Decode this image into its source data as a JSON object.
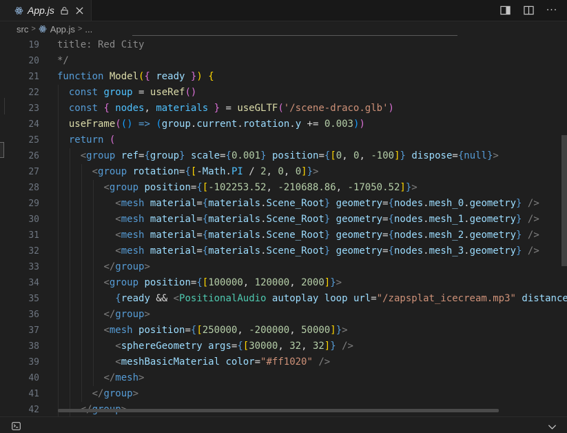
{
  "tab": {
    "icon": "react-icon",
    "label": "App.js",
    "lock_icon": "lock-icon",
    "close_icon": "close-icon"
  },
  "actions": [
    {
      "name": "toggle-secondary-sidebar-button",
      "icon": "sidebar-right-icon"
    },
    {
      "name": "split-editor-button",
      "icon": "split-editor-icon"
    },
    {
      "name": "more-actions-button",
      "label": "···"
    }
  ],
  "breadcrumb": {
    "folder": "src",
    "file": "App.js",
    "more": "..."
  },
  "line_numbers": [
    "19",
    "20",
    "21",
    "22",
    "23",
    "24",
    "25",
    "26",
    "27",
    "28",
    "29",
    "30",
    "31",
    "32",
    "33",
    "34",
    "35",
    "36",
    "37",
    "38",
    "39",
    "40",
    "41",
    "42"
  ],
  "code_lines": [
    [
      [
        "cm",
        "title: Red City"
      ]
    ],
    [
      [
        "cm",
        "*/"
      ]
    ],
    [
      [
        "k",
        "function "
      ],
      [
        "f",
        "Model"
      ],
      [
        "b1",
        "("
      ],
      [
        "b2",
        "{ "
      ],
      [
        "p",
        "ready"
      ],
      [
        "b2",
        " }"
      ],
      [
        "b1",
        ")"
      ],
      [
        "v",
        " "
      ],
      [
        "b1",
        "{"
      ]
    ],
    [
      [
        "v",
        "  "
      ],
      [
        "k",
        "const "
      ],
      [
        "c2",
        "group"
      ],
      [
        "v",
        " = "
      ],
      [
        "f",
        "useRef"
      ],
      [
        "b2",
        "()"
      ]
    ],
    [
      [
        "v",
        "  "
      ],
      [
        "k",
        "const "
      ],
      [
        "b2",
        "{ "
      ],
      [
        "c2",
        "nodes"
      ],
      [
        "v",
        ", "
      ],
      [
        "c2",
        "materials"
      ],
      [
        "b2",
        " }"
      ],
      [
        "v",
        " = "
      ],
      [
        "f",
        "useGLTF"
      ],
      [
        "b2",
        "("
      ],
      [
        "s",
        "'/scene-draco.glb'"
      ],
      [
        "b2",
        ")"
      ]
    ],
    [
      [
        "v",
        "  "
      ],
      [
        "f",
        "useFrame"
      ],
      [
        "b2",
        "("
      ],
      [
        "b3",
        "()"
      ],
      [
        "v",
        " "
      ],
      [
        "k",
        "=>"
      ],
      [
        "v",
        " "
      ],
      [
        "b3",
        "("
      ],
      [
        "p",
        "group"
      ],
      [
        "v",
        "."
      ],
      [
        "p",
        "current"
      ],
      [
        "v",
        "."
      ],
      [
        "p",
        "rotation"
      ],
      [
        "v",
        "."
      ],
      [
        "p",
        "y"
      ],
      [
        "v",
        " += "
      ],
      [
        "n",
        "0.003"
      ],
      [
        "b3",
        ")"
      ],
      [
        "b2",
        ")"
      ]
    ],
    [
      [
        "v",
        "  "
      ],
      [
        "k",
        "return "
      ],
      [
        "b2",
        "("
      ]
    ],
    [
      [
        "v",
        "    "
      ],
      [
        "g",
        "<"
      ],
      [
        "k",
        "group "
      ],
      [
        "p",
        "ref"
      ],
      [
        "v",
        "="
      ],
      [
        "k",
        "{"
      ],
      [
        "p",
        "group"
      ],
      [
        "k",
        "}"
      ],
      [
        "v",
        " "
      ],
      [
        "p",
        "scale"
      ],
      [
        "v",
        "="
      ],
      [
        "k",
        "{"
      ],
      [
        "n",
        "0.001"
      ],
      [
        "k",
        "}"
      ],
      [
        "v",
        " "
      ],
      [
        "p",
        "position"
      ],
      [
        "v",
        "="
      ],
      [
        "k",
        "{"
      ],
      [
        "b1",
        "["
      ],
      [
        "n",
        "0"
      ],
      [
        "v",
        ", "
      ],
      [
        "n",
        "0"
      ],
      [
        "v",
        ", "
      ],
      [
        "n",
        "-100"
      ],
      [
        "b1",
        "]"
      ],
      [
        "k",
        "}"
      ],
      [
        "v",
        " "
      ],
      [
        "p",
        "dispose"
      ],
      [
        "v",
        "="
      ],
      [
        "k",
        "{"
      ],
      [
        "k",
        "null"
      ],
      [
        "k",
        "}"
      ],
      [
        "g",
        ">"
      ]
    ],
    [
      [
        "v",
        "      "
      ],
      [
        "g",
        "<"
      ],
      [
        "k",
        "group "
      ],
      [
        "p",
        "rotation"
      ],
      [
        "v",
        "="
      ],
      [
        "k",
        "{"
      ],
      [
        "b1",
        "["
      ],
      [
        "v",
        "-"
      ],
      [
        "p",
        "Math"
      ],
      [
        "v",
        "."
      ],
      [
        "c2",
        "PI"
      ],
      [
        "v",
        " / "
      ],
      [
        "n",
        "2"
      ],
      [
        "v",
        ", "
      ],
      [
        "n",
        "0"
      ],
      [
        "v",
        ", "
      ],
      [
        "n",
        "0"
      ],
      [
        "b1",
        "]"
      ],
      [
        "k",
        "}"
      ],
      [
        "g",
        ">"
      ]
    ],
    [
      [
        "v",
        "        "
      ],
      [
        "g",
        "<"
      ],
      [
        "k",
        "group "
      ],
      [
        "p",
        "position"
      ],
      [
        "v",
        "="
      ],
      [
        "k",
        "{"
      ],
      [
        "b1",
        "["
      ],
      [
        "n",
        "-102253.52"
      ],
      [
        "v",
        ", "
      ],
      [
        "n",
        "-210688.86"
      ],
      [
        "v",
        ", "
      ],
      [
        "n",
        "-17050.52"
      ],
      [
        "b1",
        "]"
      ],
      [
        "k",
        "}"
      ],
      [
        "g",
        ">"
      ]
    ],
    [
      [
        "v",
        "          "
      ],
      [
        "g",
        "<"
      ],
      [
        "k",
        "mesh "
      ],
      [
        "p",
        "material"
      ],
      [
        "v",
        "="
      ],
      [
        "k",
        "{"
      ],
      [
        "p",
        "materials"
      ],
      [
        "v",
        "."
      ],
      [
        "p",
        "Scene_Root"
      ],
      [
        "k",
        "}"
      ],
      [
        "v",
        " "
      ],
      [
        "p",
        "geometry"
      ],
      [
        "v",
        "="
      ],
      [
        "k",
        "{"
      ],
      [
        "p",
        "nodes"
      ],
      [
        "v",
        "."
      ],
      [
        "p",
        "mesh_0"
      ],
      [
        "v",
        "."
      ],
      [
        "p",
        "geometry"
      ],
      [
        "k",
        "}"
      ],
      [
        "v",
        " "
      ],
      [
        "g",
        "/>"
      ]
    ],
    [
      [
        "v",
        "          "
      ],
      [
        "g",
        "<"
      ],
      [
        "k",
        "mesh "
      ],
      [
        "p",
        "material"
      ],
      [
        "v",
        "="
      ],
      [
        "k",
        "{"
      ],
      [
        "p",
        "materials"
      ],
      [
        "v",
        "."
      ],
      [
        "p",
        "Scene_Root"
      ],
      [
        "k",
        "}"
      ],
      [
        "v",
        " "
      ],
      [
        "p",
        "geometry"
      ],
      [
        "v",
        "="
      ],
      [
        "k",
        "{"
      ],
      [
        "p",
        "nodes"
      ],
      [
        "v",
        "."
      ],
      [
        "p",
        "mesh_1"
      ],
      [
        "v",
        "."
      ],
      [
        "p",
        "geometry"
      ],
      [
        "k",
        "}"
      ],
      [
        "v",
        " "
      ],
      [
        "g",
        "/>"
      ]
    ],
    [
      [
        "v",
        "          "
      ],
      [
        "g",
        "<"
      ],
      [
        "k",
        "mesh "
      ],
      [
        "p",
        "material"
      ],
      [
        "v",
        "="
      ],
      [
        "k",
        "{"
      ],
      [
        "p",
        "materials"
      ],
      [
        "v",
        "."
      ],
      [
        "p",
        "Scene_Root"
      ],
      [
        "k",
        "}"
      ],
      [
        "v",
        " "
      ],
      [
        "p",
        "geometry"
      ],
      [
        "v",
        "="
      ],
      [
        "k",
        "{"
      ],
      [
        "p",
        "nodes"
      ],
      [
        "v",
        "."
      ],
      [
        "p",
        "mesh_2"
      ],
      [
        "v",
        "."
      ],
      [
        "p",
        "geometry"
      ],
      [
        "k",
        "}"
      ],
      [
        "v",
        " "
      ],
      [
        "g",
        "/>"
      ]
    ],
    [
      [
        "v",
        "          "
      ],
      [
        "g",
        "<"
      ],
      [
        "k",
        "mesh "
      ],
      [
        "p",
        "material"
      ],
      [
        "v",
        "="
      ],
      [
        "k",
        "{"
      ],
      [
        "p",
        "materials"
      ],
      [
        "v",
        "."
      ],
      [
        "p",
        "Scene_Root"
      ],
      [
        "k",
        "}"
      ],
      [
        "v",
        " "
      ],
      [
        "p",
        "geometry"
      ],
      [
        "v",
        "="
      ],
      [
        "k",
        "{"
      ],
      [
        "p",
        "nodes"
      ],
      [
        "v",
        "."
      ],
      [
        "p",
        "mesh_3"
      ],
      [
        "v",
        "."
      ],
      [
        "p",
        "geometry"
      ],
      [
        "k",
        "}"
      ],
      [
        "v",
        " "
      ],
      [
        "g",
        "/>"
      ]
    ],
    [
      [
        "v",
        "        "
      ],
      [
        "g",
        "</"
      ],
      [
        "k",
        "group"
      ],
      [
        "g",
        ">"
      ]
    ],
    [
      [
        "v",
        "        "
      ],
      [
        "g",
        "<"
      ],
      [
        "k",
        "group "
      ],
      [
        "p",
        "position"
      ],
      [
        "v",
        "="
      ],
      [
        "k",
        "{"
      ],
      [
        "b1",
        "["
      ],
      [
        "n",
        "100000"
      ],
      [
        "v",
        ", "
      ],
      [
        "n",
        "120000"
      ],
      [
        "v",
        ", "
      ],
      [
        "n",
        "2000"
      ],
      [
        "b1",
        "]"
      ],
      [
        "k",
        "}"
      ],
      [
        "g",
        ">"
      ]
    ],
    [
      [
        "v",
        "          "
      ],
      [
        "k",
        "{"
      ],
      [
        "p",
        "ready"
      ],
      [
        "v",
        " && "
      ],
      [
        "g",
        "<"
      ],
      [
        "t",
        "PositionalAudio "
      ],
      [
        "p",
        "autoplay"
      ],
      [
        "v",
        " "
      ],
      [
        "p",
        "loop"
      ],
      [
        "v",
        " "
      ],
      [
        "p",
        "url"
      ],
      [
        "v",
        "="
      ],
      [
        "s",
        "\"/zapsplat_icecream.mp3\""
      ],
      [
        "v",
        " "
      ],
      [
        "p",
        "distance"
      ]
    ],
    [
      [
        "v",
        "        "
      ],
      [
        "g",
        "</"
      ],
      [
        "k",
        "group"
      ],
      [
        "g",
        ">"
      ]
    ],
    [
      [
        "v",
        "        "
      ],
      [
        "g",
        "<"
      ],
      [
        "k",
        "mesh "
      ],
      [
        "p",
        "position"
      ],
      [
        "v",
        "="
      ],
      [
        "k",
        "{"
      ],
      [
        "b1",
        "["
      ],
      [
        "n",
        "250000"
      ],
      [
        "v",
        ", "
      ],
      [
        "n",
        "-200000"
      ],
      [
        "v",
        ", "
      ],
      [
        "n",
        "50000"
      ],
      [
        "b1",
        "]"
      ],
      [
        "k",
        "}"
      ],
      [
        "g",
        ">"
      ]
    ],
    [
      [
        "v",
        "          "
      ],
      [
        "g",
        "<"
      ],
      [
        "p",
        "sphereGeometry "
      ],
      [
        "p",
        "args"
      ],
      [
        "v",
        "="
      ],
      [
        "k",
        "{"
      ],
      [
        "b1",
        "["
      ],
      [
        "n",
        "30000"
      ],
      [
        "v",
        ", "
      ],
      [
        "n",
        "32"
      ],
      [
        "v",
        ", "
      ],
      [
        "n",
        "32"
      ],
      [
        "b1",
        "]"
      ],
      [
        "k",
        "}"
      ],
      [
        "v",
        " "
      ],
      [
        "g",
        "/>"
      ]
    ],
    [
      [
        "v",
        "          "
      ],
      [
        "g",
        "<"
      ],
      [
        "p",
        "meshBasicMaterial "
      ],
      [
        "p",
        "color"
      ],
      [
        "v",
        "="
      ],
      [
        "s",
        "\"#ff1020\""
      ],
      [
        "v",
        " "
      ],
      [
        "g",
        "/>"
      ]
    ],
    [
      [
        "v",
        "        "
      ],
      [
        "g",
        "</"
      ],
      [
        "k",
        "mesh"
      ],
      [
        "g",
        ">"
      ]
    ],
    [
      [
        "v",
        "      "
      ],
      [
        "g",
        "</"
      ],
      [
        "k",
        "group"
      ],
      [
        "g",
        ">"
      ]
    ],
    [
      [
        "v",
        "    "
      ],
      [
        "g",
        "</"
      ],
      [
        "k",
        "group"
      ],
      [
        "g",
        ">"
      ]
    ]
  ],
  "bottom": {
    "terminal_icon": "terminal-icon",
    "chevron_icon": "chevron-down-icon"
  }
}
